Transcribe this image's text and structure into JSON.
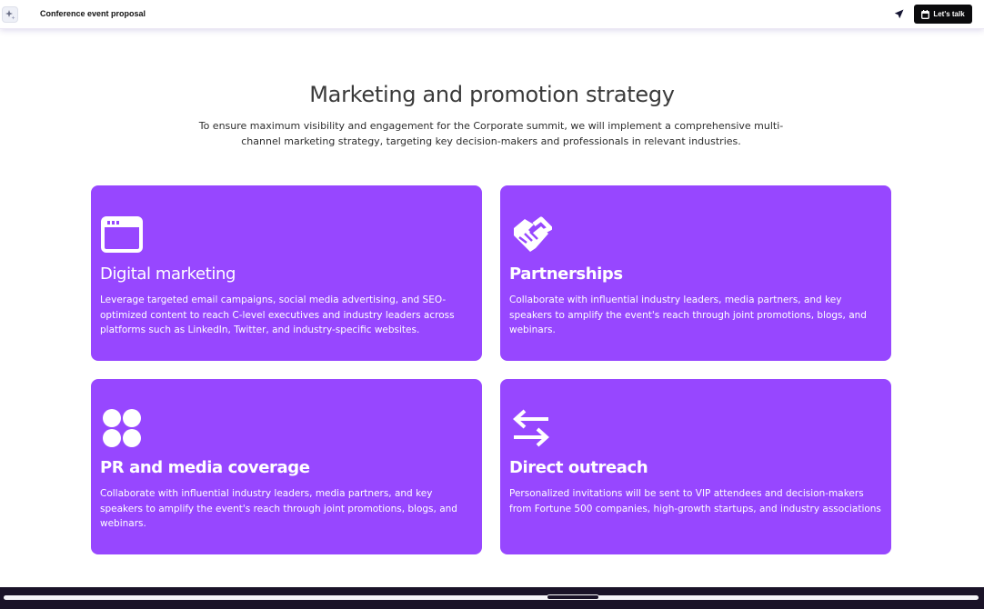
{
  "header": {
    "doc_title": "Conference event proposal",
    "cta_label": "Let's talk",
    "logo_icon": "sparkle-icon",
    "share_icon": "send-arrow-icon",
    "cta_icon": "calendar-icon"
  },
  "section": {
    "title": "Marketing and promotion strategy",
    "intro": "To ensure maximum visibility and engagement for the Corporate summit, we will implement a comprehensive multi-channel marketing strategy, targeting key decision-makers and professionals in relevant industries."
  },
  "cards": [
    {
      "icon": "browser-window-icon",
      "title": "Digital marketing",
      "text": "Leverage targeted email campaigns, social media advertising, and SEO-optimized content to reach C-level executives and industry leaders across platforms such as LinkedIn, Twitter, and industry-specific websites."
    },
    {
      "icon": "handshake-icon",
      "title": "Partnerships",
      "text": "Collaborate with influential industry leaders, media partners, and key speakers to amplify the event's reach through joint promotions, blogs, and webinars."
    },
    {
      "icon": "four-circles-icon",
      "title": "PR and media coverage",
      "text": "Collaborate with influential industry leaders, media partners, and key speakers to amplify the event's reach through joint promotions, blogs, and webinars."
    },
    {
      "icon": "swap-arrows-icon",
      "title": "Direct outreach",
      "text": "Personalized invitations will be sent to VIP attendees and decision-makers from Fortune 500 companies, high-growth startups, and industry associations"
    }
  ],
  "colors": {
    "card_background": "#9747ff",
    "cta_background": "#0b0b0d",
    "title_text": "#3a3a3a"
  }
}
